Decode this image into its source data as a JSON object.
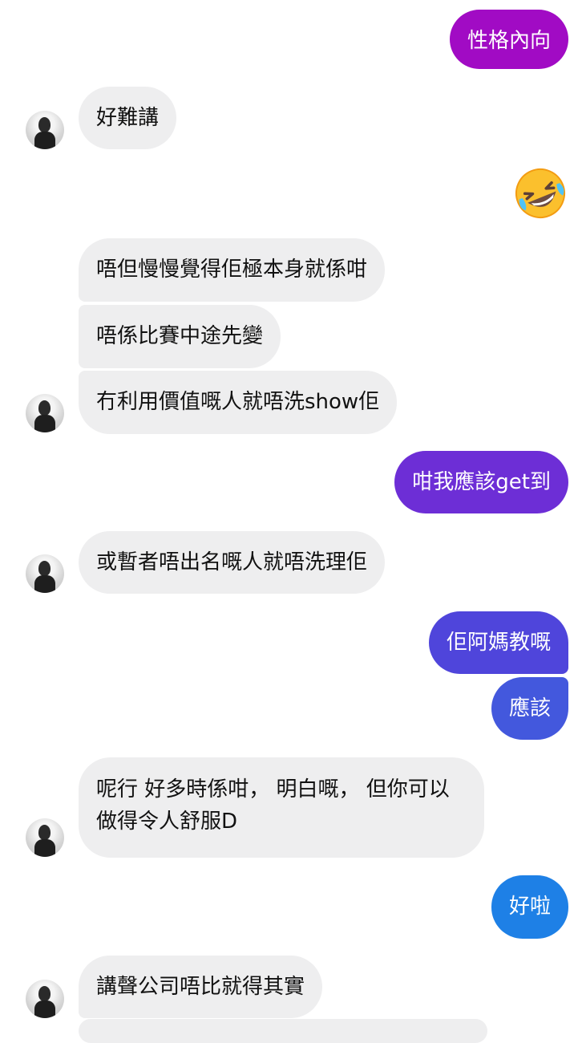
{
  "conversation": {
    "messages": [
      {
        "from": "me",
        "text": "性格內向"
      },
      {
        "from": "contact",
        "text": "好難講"
      },
      {
        "from": "me",
        "emoji": "rolling-on-floor-laughing"
      },
      {
        "from": "contact",
        "text": "唔但慢慢覺得佢極本身就係咁"
      },
      {
        "from": "contact",
        "text": "唔係比賽中途先變"
      },
      {
        "from": "contact",
        "text": "冇利用價值嘅人就唔洗show佢"
      },
      {
        "from": "me",
        "text": "咁我應該get到"
      },
      {
        "from": "contact",
        "text": "或暫者唔出名嘅人就唔洗理佢"
      },
      {
        "from": "me",
        "text": "佢阿媽教嘅"
      },
      {
        "from": "me",
        "text": "應該"
      },
      {
        "from": "contact",
        "text": "呢行 好多時係咁， 明白嘅， 但你可以做得令人舒服D"
      },
      {
        "from": "me",
        "text": "好啦"
      },
      {
        "from": "contact",
        "text": "講聲公司唔比就得其實"
      }
    ]
  },
  "colors": {
    "incoming_bubble": "#eeeeef",
    "outgoing_gradient": [
      "#a10bc4",
      "#6d2ed6",
      "#4f45db",
      "#2f6ae0",
      "#1e80e6"
    ]
  }
}
